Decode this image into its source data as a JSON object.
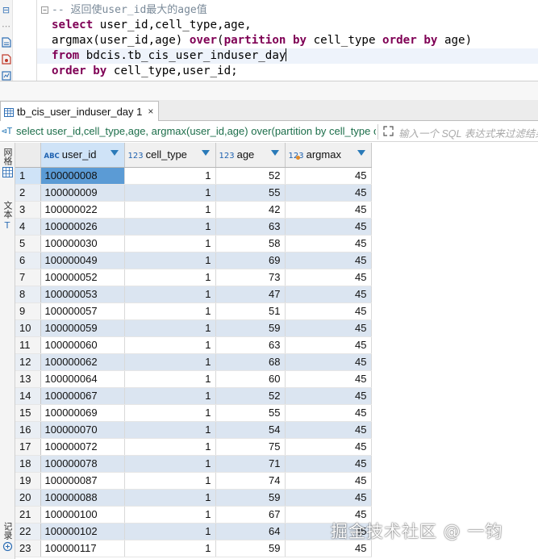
{
  "editor": {
    "comment": "-- 返回使user_id最大的age值",
    "line2": {
      "kw": "select",
      "rest": " user_id,cell_type,age,"
    },
    "line3": {
      "a": "argmax(user_id,age) ",
      "kw1": "over",
      "b": "(",
      "kw2": "partition",
      "c": " ",
      "kw3": "by",
      "d": " cell_type ",
      "kw4": "order",
      "e": " ",
      "kw5": "by",
      "f": " age)"
    },
    "line4": {
      "kw": "from",
      "rest": " bdcis.tb_cis_user_induser_day"
    },
    "line5": {
      "kw1": "order",
      "a": " ",
      "kw2": "by",
      "rest": " cell_type,user_id;"
    }
  },
  "result_tab": {
    "label": "tb_cis_user_induser_day 1",
    "close": "×"
  },
  "query_bar": {
    "filter_icon": "⊲T",
    "query": "select user_id,cell_type,age, argmax(user_id,age) over(partition by cell_type o",
    "placeholder": "输入一个 SQL 表达式来过滤结果"
  },
  "side_toolbar": {
    "grid_label": "网格",
    "text_label": "文本",
    "record_label": "记录"
  },
  "grid": {
    "columns": [
      {
        "name": "user_id",
        "type": "ABC"
      },
      {
        "name": "cell_type",
        "type": "123"
      },
      {
        "name": "age",
        "type": "123"
      },
      {
        "name": "argmax",
        "type": "123"
      }
    ],
    "rows": [
      [
        "1",
        "100000008",
        "1",
        "52",
        "45"
      ],
      [
        "2",
        "100000009",
        "1",
        "55",
        "45"
      ],
      [
        "3",
        "100000022",
        "1",
        "42",
        "45"
      ],
      [
        "4",
        "100000026",
        "1",
        "63",
        "45"
      ],
      [
        "5",
        "100000030",
        "1",
        "58",
        "45"
      ],
      [
        "6",
        "100000049",
        "1",
        "69",
        "45"
      ],
      [
        "7",
        "100000052",
        "1",
        "73",
        "45"
      ],
      [
        "8",
        "100000053",
        "1",
        "47",
        "45"
      ],
      [
        "9",
        "100000057",
        "1",
        "51",
        "45"
      ],
      [
        "10",
        "100000059",
        "1",
        "59",
        "45"
      ],
      [
        "11",
        "100000060",
        "1",
        "63",
        "45"
      ],
      [
        "12",
        "100000062",
        "1",
        "68",
        "45"
      ],
      [
        "13",
        "100000064",
        "1",
        "60",
        "45"
      ],
      [
        "14",
        "100000067",
        "1",
        "52",
        "45"
      ],
      [
        "15",
        "100000069",
        "1",
        "55",
        "45"
      ],
      [
        "16",
        "100000070",
        "1",
        "54",
        "45"
      ],
      [
        "17",
        "100000072",
        "1",
        "75",
        "45"
      ],
      [
        "18",
        "100000078",
        "1",
        "71",
        "45"
      ],
      [
        "19",
        "100000087",
        "1",
        "74",
        "45"
      ],
      [
        "20",
        "100000088",
        "1",
        "59",
        "45"
      ],
      [
        "21",
        "100000100",
        "1",
        "67",
        "45"
      ],
      [
        "22",
        "100000102",
        "1",
        "64",
        "45"
      ],
      [
        "23",
        "100000117",
        "1",
        "59",
        "45"
      ]
    ]
  },
  "watermark": "掘金技术社区 @ 一钧",
  "colors": {
    "keyword": "#7f0055",
    "query_text": "#1c6e4a",
    "row_alt": "#dbe5f1",
    "selected_cell": "#5b9bd5"
  }
}
